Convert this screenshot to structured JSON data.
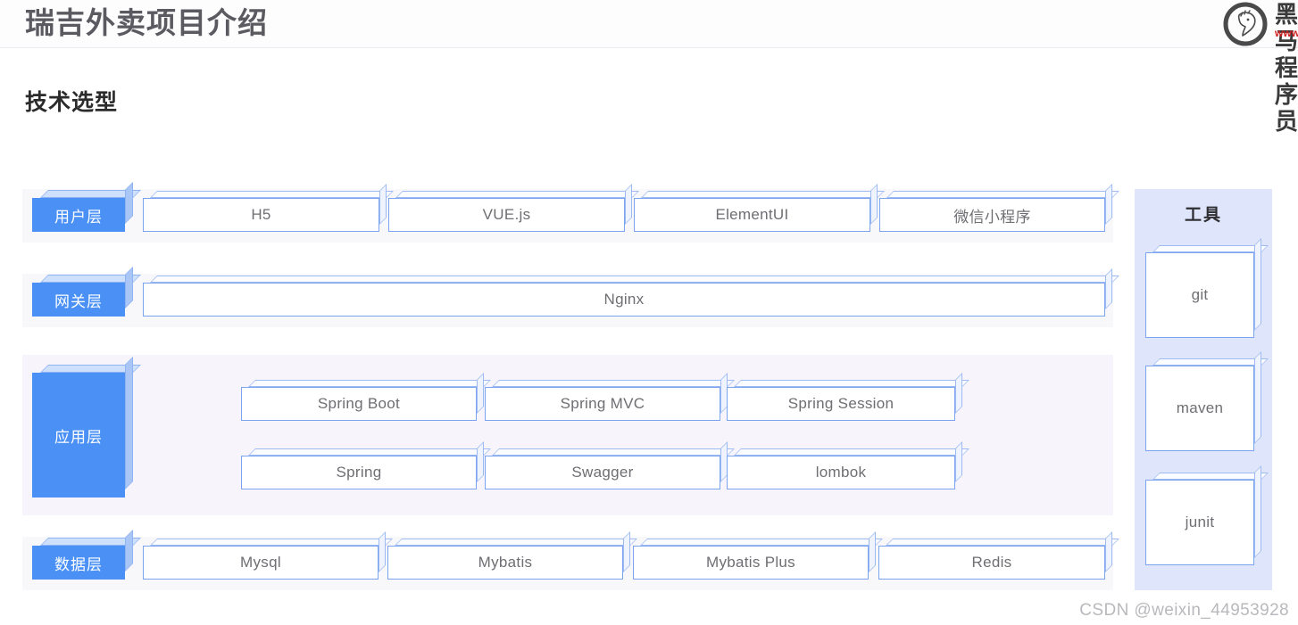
{
  "header": {
    "title": "瑞吉外卖项目介绍",
    "brand": {
      "logo_icon": "horse-head-circle-logo",
      "name": "黑马程序员",
      "url": "www.itheima.com"
    },
    "divider_color": "#eceaf0"
  },
  "section": {
    "title": "技术选型"
  },
  "colors": {
    "accent_blue": "#4a90f5",
    "box_border": "#7ba4f0",
    "box_top": "#fbfcff",
    "box_side": "#eef3fd",
    "row_band": "#f8f7fa",
    "app_row_band": "#f7f5fb",
    "tools_panel_bg": "#dfe5fa",
    "label_text": "#6e6e73",
    "watermark_text": "#b9b9bd"
  },
  "rows": [
    {
      "id": "user-layer",
      "layer_label": "用户层",
      "items": [
        {
          "label": "H5"
        },
        {
          "label": "VUE.js"
        },
        {
          "label": "ElementUI"
        },
        {
          "label": "微信小程序"
        }
      ]
    },
    {
      "id": "gateway-layer",
      "layer_label": "网关层",
      "items": [
        {
          "label": "Nginx"
        }
      ]
    },
    {
      "id": "application-layer",
      "layer_label": "应用层",
      "items": [
        {
          "label": "Spring Boot"
        },
        {
          "label": "Spring MVC"
        },
        {
          "label": "Spring Session"
        },
        {
          "label": "Spring"
        },
        {
          "label": "Swagger"
        },
        {
          "label": "lombok"
        }
      ]
    },
    {
      "id": "data-layer",
      "layer_label": "数据层",
      "items": [
        {
          "label": "Mysql"
        },
        {
          "label": "Mybatis"
        },
        {
          "label": "Mybatis Plus"
        },
        {
          "label": "Redis"
        }
      ]
    }
  ],
  "tools": {
    "title": "工具",
    "items": [
      {
        "label": "git"
      },
      {
        "label": "maven"
      },
      {
        "label": "junit"
      }
    ]
  },
  "watermark": {
    "text": "CSDN @weixin_44953928"
  }
}
